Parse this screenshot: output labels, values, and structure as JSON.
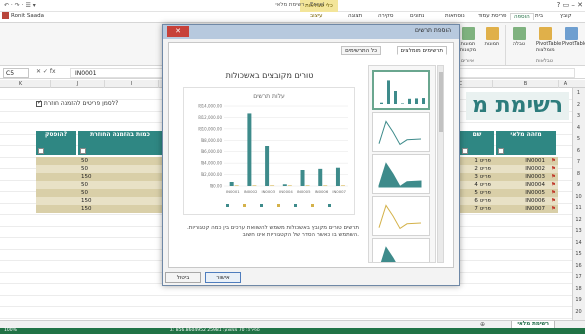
{
  "titlebar": {
    "qat": "↶ · ↷ · ☰ ▾",
    "title": "רשימת מלאי - Excel",
    "context_tab": "כלי טבלאות",
    "window_buttons": "? ▭ – ✕"
  },
  "account": {
    "name": "Ronit Saada"
  },
  "ribbon_tabs": [
    "קובץ",
    "בית",
    "הוספה",
    "פריסת עמוד",
    "נוסחאות",
    "נתונים",
    "סקירה",
    "תצוגה",
    "עיצוב"
  ],
  "active_tab": "הוספה",
  "ribbon_groups": [
    {
      "label": "טבלאות",
      "buttons": [
        "PivotTable",
        "PivotTable מומלצות",
        "טבלה"
      ]
    },
    {
      "label": "איורים",
      "buttons": [
        "תמונות",
        "תמונות מקוונות",
        "צורות"
      ]
    },
    {
      "label": "תרשימים",
      "buttons": [
        "תרשימים מומלצים",
        "תרשים PivotChart"
      ]
    },
    {
      "label": "מסננים",
      "buttons": [
        "פורס",
        "ציר זמן"
      ]
    },
    {
      "label": "קישורים",
      "buttons": [
        "היפר-קישור"
      ]
    },
    {
      "label": "טקסט",
      "buttons": [
        "תיבת טקסט",
        "כותרת עליונה ותחתונה"
      ]
    },
    {
      "label": "סמלים",
      "buttons": [
        "משוואה",
        "סמל"
      ]
    }
  ],
  "formula_bar": {
    "name_box": "C5",
    "fx": "✕  ✓  fx",
    "formula": "IN0001"
  },
  "columns": [
    "A",
    "B",
    "C",
    "D",
    "E",
    "F",
    "G",
    "H",
    "I",
    "J",
    "K"
  ],
  "rows": [
    "1",
    "2",
    "3",
    "4",
    "5",
    "6",
    "7",
    "8",
    "9",
    "10",
    "11",
    "12",
    "13",
    "14",
    "15",
    "16",
    "17",
    "18",
    "19",
    "20"
  ],
  "sheet": {
    "title": "רשימת מ",
    "checkbox_label": "לסמן פריטים להזמנה חוזרת?"
  },
  "table": {
    "headers": {
      "id": "מזהה מלאי",
      "name": "שם",
      "reorder_qty": "כמות בהזמנה החוזרת",
      "discontinued": "הופסק?"
    },
    "rows": [
      {
        "id": "IN0001",
        "name": "פריט 1",
        "qty": "50"
      },
      {
        "id": "IN0002",
        "name": "פריט 2",
        "qty": "50"
      },
      {
        "id": "IN0003",
        "name": "פריט 3",
        "qty": "150"
      },
      {
        "id": "IN0004",
        "name": "פריט 4",
        "qty": "50"
      },
      {
        "id": "IN0005",
        "name": "פריט 5",
        "qty": "50"
      },
      {
        "id": "IN0006",
        "name": "פריט 6",
        "qty": "150"
      },
      {
        "id": "IN0007",
        "name": "פריט 7",
        "qty": "150"
      }
    ]
  },
  "dialog": {
    "title": "הוספת תרשים",
    "close": "✕",
    "tabs": [
      "תרשימים מומלצים",
      "כל התרשימים"
    ],
    "preview_title": "טורים מקובצים באשכולות",
    "description": "תרשים טורים מקובץ באשכולות משמש להשוואת ערכים בין כמה קטגוריות. השתמש בו כאשר הסדר של הקטגוריות אינו חשוב.",
    "ok": "אישור",
    "cancel": "ביטול"
  },
  "sheet_tab": "רשימת מלאי",
  "add_sheet": "⊕",
  "status": {
    "left": "Σ: 856.8604952   ספירה: 70   ממוצע: 25981",
    "zoom": "100%"
  },
  "chart_data": {
    "type": "bar",
    "title": "עלות תרשים",
    "categories": [
      "IN0001",
      "IN0002",
      "IN0003",
      "IN0004",
      "IN0005",
      "IN0006",
      "IN0007"
    ],
    "series": [
      {
        "values": [
          700,
          12700,
          7000,
          300,
          2800,
          3000,
          3200
        ]
      },
      {
        "values": [
          100,
          100,
          100,
          100,
          100,
          100,
          100
        ]
      }
    ],
    "y_ticks": [
      "₪14,000.00",
      "₪12,000.00",
      "₪10,000.00",
      "₪8,000.00",
      "₪6,000.00",
      "₪4,000.00",
      "₪2,000.00",
      "₪0.00"
    ],
    "ylim": [
      0,
      14000
    ],
    "grid": true,
    "legend": "bottom"
  },
  "colors": {
    "accent": "#217346",
    "table_header": "#2f8783",
    "row_band": "#d9cfa8",
    "bar": "#3e8b8b"
  }
}
